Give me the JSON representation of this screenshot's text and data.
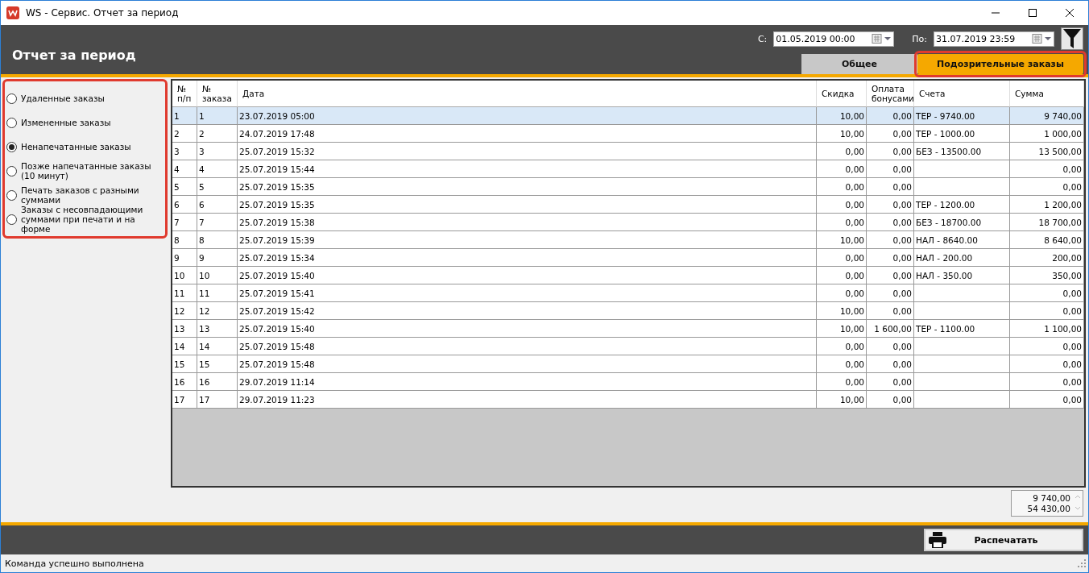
{
  "window": {
    "title": "WS - Сервис. Отчет за период"
  },
  "header": {
    "title": "Отчет за период",
    "from_label": "С:",
    "from_value": "01.05.2019 00:00",
    "to_label": "По:",
    "to_value": "31.07.2019 23:59"
  },
  "tabs": [
    {
      "label": "Общее",
      "selected": false
    },
    {
      "label": "Подозрительные заказы",
      "selected": true
    }
  ],
  "filters": [
    {
      "label": "Удаленные заказы",
      "selected": false
    },
    {
      "label": "Измененные заказы",
      "selected": false
    },
    {
      "label": "Ненапечатанные заказы",
      "selected": true
    },
    {
      "label": "Позже напечатанные заказы (10 минут)",
      "selected": false
    },
    {
      "label": "Печать заказов с разными суммами",
      "selected": false
    },
    {
      "label": "Заказы с несовпадающими суммами при печати и на форме",
      "selected": false
    }
  ],
  "table": {
    "columns": [
      "№ п/п",
      "№ заказа",
      "Дата",
      "Скидка",
      "Оплата бонусами",
      "Счета",
      "Сумма"
    ],
    "rows": [
      {
        "cells": [
          "1",
          "1",
          "23.07.2019 05:00",
          "10,00",
          "0,00",
          "ТЕР - 9740.00",
          "9 740,00"
        ],
        "selected": true
      },
      {
        "cells": [
          "2",
          "2",
          "24.07.2019 17:48",
          "10,00",
          "0,00",
          "ТЕР - 1000.00",
          "1 000,00"
        ],
        "selected": false
      },
      {
        "cells": [
          "3",
          "3",
          "25.07.2019 15:32",
          "0,00",
          "0,00",
          "БЕЗ - 13500.00",
          "13 500,00"
        ],
        "selected": false
      },
      {
        "cells": [
          "4",
          "4",
          "25.07.2019 15:44",
          "0,00",
          "0,00",
          "",
          "0,00"
        ],
        "selected": false
      },
      {
        "cells": [
          "5",
          "5",
          "25.07.2019 15:35",
          "0,00",
          "0,00",
          "",
          "0,00"
        ],
        "selected": false
      },
      {
        "cells": [
          "6",
          "6",
          "25.07.2019 15:35",
          "0,00",
          "0,00",
          "ТЕР - 1200.00",
          "1 200,00"
        ],
        "selected": false
      },
      {
        "cells": [
          "7",
          "7",
          "25.07.2019 15:38",
          "0,00",
          "0,00",
          "БЕЗ - 18700.00",
          "18 700,00"
        ],
        "selected": false
      },
      {
        "cells": [
          "8",
          "8",
          "25.07.2019 15:39",
          "10,00",
          "0,00",
          "НАЛ - 8640.00",
          "8 640,00"
        ],
        "selected": false
      },
      {
        "cells": [
          "9",
          "9",
          "25.07.2019 15:34",
          "0,00",
          "0,00",
          "НАЛ - 200.00",
          "200,00"
        ],
        "selected": false
      },
      {
        "cells": [
          "10",
          "10",
          "25.07.2019 15:40",
          "0,00",
          "0,00",
          "НАЛ - 350.00",
          "350,00"
        ],
        "selected": false
      },
      {
        "cells": [
          "11",
          "11",
          "25.07.2019 15:41",
          "0,00",
          "0,00",
          "",
          "0,00"
        ],
        "selected": false
      },
      {
        "cells": [
          "12",
          "12",
          "25.07.2019 15:42",
          "10,00",
          "0,00",
          "",
          "0,00"
        ],
        "selected": false
      },
      {
        "cells": [
          "13",
          "13",
          "25.07.2019 15:40",
          "10,00",
          "1 600,00",
          "ТЕР - 1100.00",
          "1 100,00"
        ],
        "selected": false
      },
      {
        "cells": [
          "14",
          "14",
          "25.07.2019 15:48",
          "0,00",
          "0,00",
          "",
          "0,00"
        ],
        "selected": false
      },
      {
        "cells": [
          "15",
          "15",
          "25.07.2019 15:48",
          "0,00",
          "0,00",
          "",
          "0,00"
        ],
        "selected": false
      },
      {
        "cells": [
          "16",
          "16",
          "29.07.2019 11:14",
          "0,00",
          "0,00",
          "",
          "0,00"
        ],
        "selected": false
      },
      {
        "cells": [
          "17",
          "17",
          "29.07.2019 11:23",
          "10,00",
          "0,00",
          "",
          "0,00"
        ],
        "selected": false
      }
    ]
  },
  "totals": [
    "9 740,00",
    "54 430,00"
  ],
  "print_button": "Распечатать",
  "status_bar": "Команда успешно выполнена"
}
